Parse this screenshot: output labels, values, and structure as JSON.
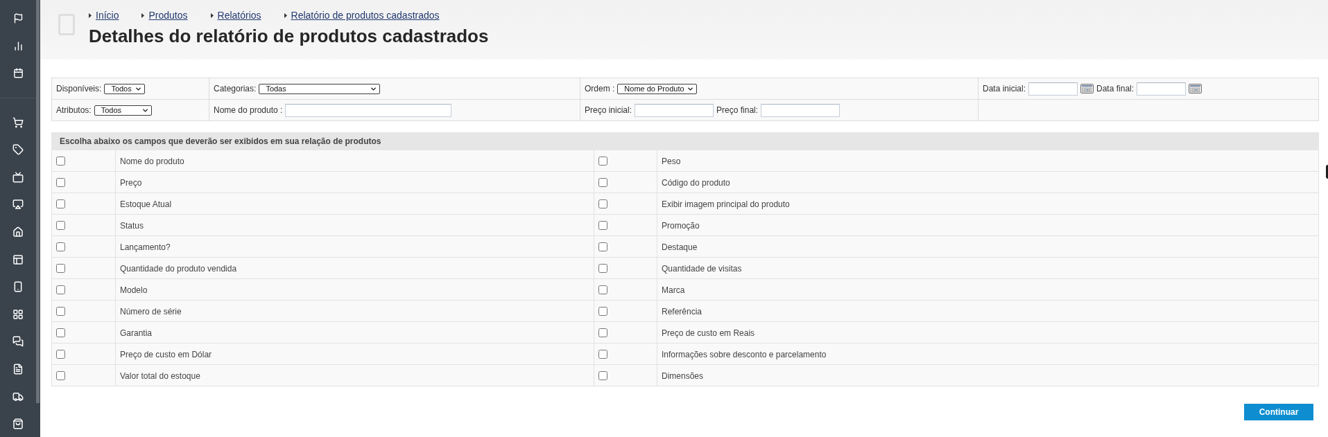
{
  "header": {
    "breadcrumbs": [
      {
        "label": "Início"
      },
      {
        "label": "Produtos"
      },
      {
        "label": "Relatórios"
      },
      {
        "label": "Relatório de produtos cadastrados"
      }
    ],
    "title": "Detalhes do relatório de produtos cadastrados"
  },
  "filters": {
    "rows": [
      {
        "cells": [
          {
            "fields": [
              {
                "kind": "select",
                "label": "Disponíveis:",
                "value": "Todos"
              }
            ]
          },
          {
            "fields": [
              {
                "kind": "select",
                "label": "Categorias:",
                "value": "Todas"
              }
            ]
          },
          {
            "fields": [
              {
                "kind": "select",
                "label": "Ordem :",
                "value": "Nome do Produto"
              }
            ]
          },
          {
            "fields": [
              {
                "kind": "date",
                "label": "Data inicial:"
              },
              {
                "kind": "date",
                "label": "Data final:"
              }
            ]
          }
        ]
      },
      {
        "cells": [
          {
            "fields": [
              {
                "kind": "select",
                "label": "Atributos:",
                "value": "Todos"
              }
            ]
          },
          {
            "fields": [
              {
                "kind": "text",
                "label": "Nome do produto :"
              }
            ]
          },
          {
            "fields": [
              {
                "kind": "text",
                "label": "Preço inicial:"
              },
              {
                "kind": "text",
                "label": "Preço final:"
              }
            ]
          }
        ]
      }
    ]
  },
  "field_picker": {
    "heading": "Escolha abaixo os campos que deverão ser exibidos em sua relação de produtos",
    "rows": [
      {
        "options": [
          {
            "label": "Nome do produto",
            "checked": false
          },
          {
            "label": "Peso",
            "checked": false
          }
        ]
      },
      {
        "options": [
          {
            "label": "Preço",
            "checked": false
          },
          {
            "label": "Código do produto",
            "checked": false
          }
        ]
      },
      {
        "options": [
          {
            "label": "Estoque Atual",
            "checked": false
          },
          {
            "label": "Exibir imagem principal do produto",
            "checked": false
          }
        ]
      },
      {
        "options": [
          {
            "label": "Status",
            "checked": false
          },
          {
            "label": "Promoção",
            "checked": false
          }
        ]
      },
      {
        "options": [
          {
            "label": "Lançamento?",
            "checked": false
          },
          {
            "label": "Destaque",
            "checked": false
          }
        ]
      },
      {
        "options": [
          {
            "label": "Quantidade do produto vendida",
            "checked": false
          },
          {
            "label": "Quantidade de visitas",
            "checked": false
          }
        ]
      },
      {
        "options": [
          {
            "label": "Modelo",
            "checked": false
          },
          {
            "label": "Marca",
            "checked": false
          }
        ]
      },
      {
        "options": [
          {
            "label": "Número de série",
            "checked": false
          },
          {
            "label": "Referência",
            "checked": false
          }
        ]
      },
      {
        "options": [
          {
            "label": "Garantia",
            "checked": false
          },
          {
            "label": "Preço de custo em Reais",
            "checked": false
          }
        ]
      },
      {
        "options": [
          {
            "label": "Preço de custo em Dólar",
            "checked": false
          },
          {
            "label": "Informações sobre desconto e parcelamento",
            "checked": false
          }
        ]
      },
      {
        "options": [
          {
            "label": "Valor total do estoque",
            "checked": false
          },
          {
            "label": "Dimensões",
            "checked": false
          }
        ]
      }
    ]
  },
  "actions": {
    "continue_button": "Continuar"
  }
}
